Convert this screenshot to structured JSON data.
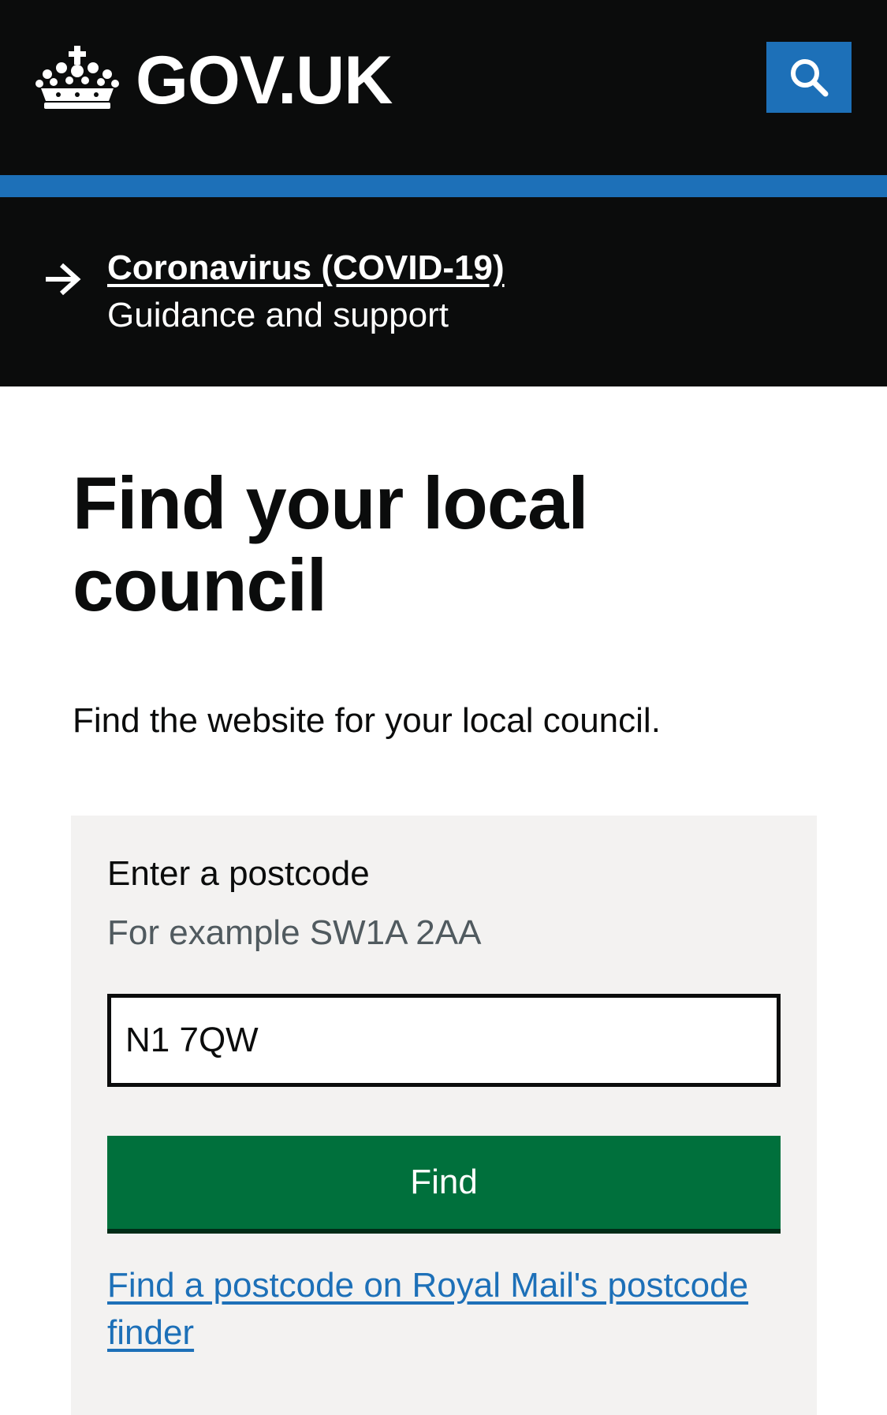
{
  "header": {
    "logo_text": "GOV.UK",
    "search_icon": "search-icon",
    "crown_icon": "crown-icon"
  },
  "banner": {
    "link_text": "Coronavirus (COVID-19)",
    "subtext": "Guidance and support",
    "arrow_icon": "arrow-right-icon"
  },
  "main": {
    "title": "Find your local council",
    "lede": "Find the website for your local council."
  },
  "form": {
    "label": "Enter a postcode",
    "hint": "For example SW1A 2AA",
    "postcode_value": "N1 7QW",
    "button_label": "Find",
    "postcode_finder_link": "Find a postcode on Royal Mail's postcode finder"
  },
  "colors": {
    "header_bg": "#0b0c0c",
    "brand_blue": "#1d70b8",
    "button_green": "#00703c",
    "panel_bg": "#f3f2f1",
    "hint_grey": "#505a5f"
  }
}
